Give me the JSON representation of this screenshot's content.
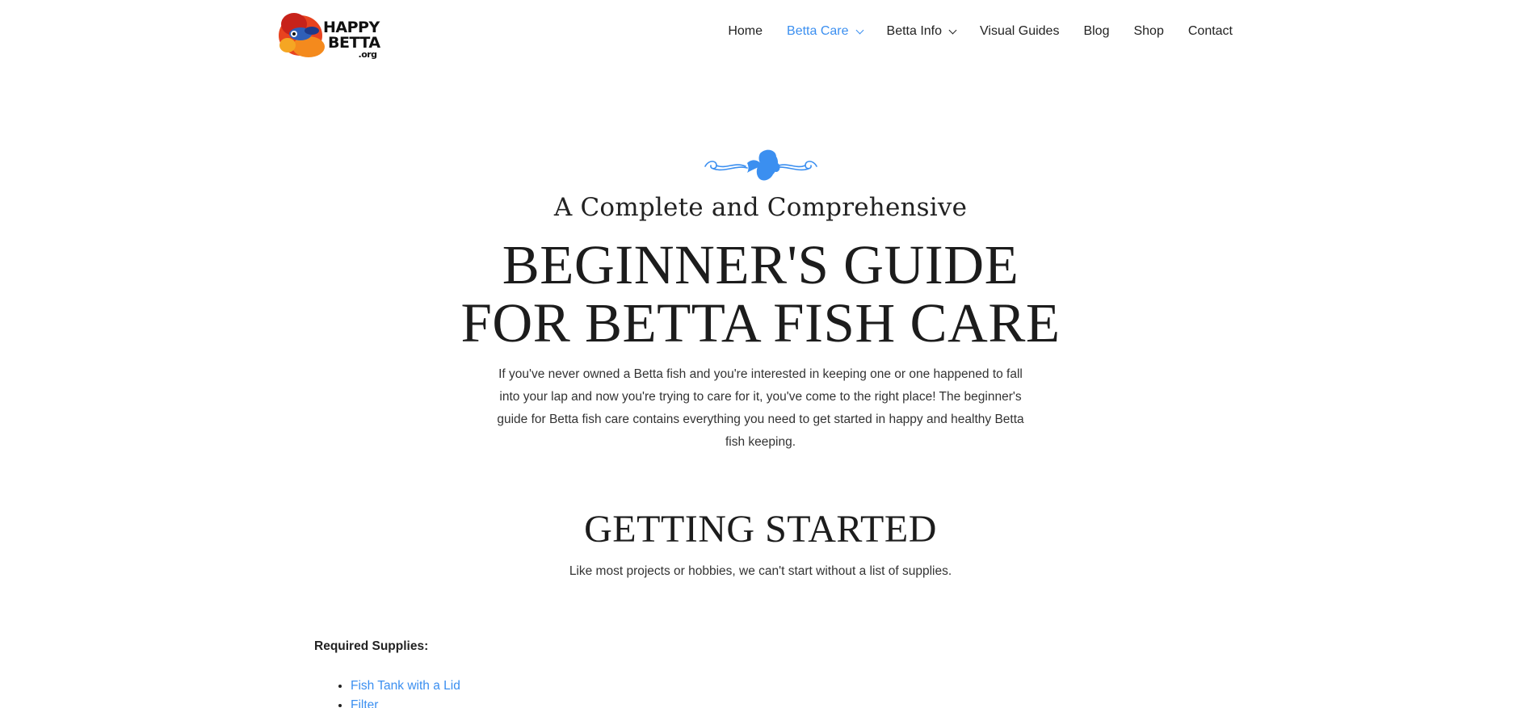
{
  "brand": {
    "logo_line1": "HAPPY",
    "logo_line2": "BETTA",
    "logo_line3": ".org"
  },
  "nav": {
    "items": [
      {
        "label": "Home"
      },
      {
        "label": "Betta Care",
        "active": true,
        "dropdown": true
      },
      {
        "label": "Betta Info",
        "dropdown": true
      },
      {
        "label": "Visual Guides"
      },
      {
        "label": "Blog"
      },
      {
        "label": "Shop"
      },
      {
        "label": "Contact"
      }
    ]
  },
  "hero": {
    "divider_icon": "betta-fish-flourish-icon",
    "subtitle": "A Complete and Comprehensive",
    "title": "BEGINNER'S GUIDE FOR BETTA FISH CARE",
    "intro": "If you've never owned a Betta fish and you're interested in keeping one or one happened to fall into your lap and now you're trying to care for it, you've come to the right place! The beginner's guide for Betta fish care contains everything you need to get started in happy and healthy Betta fish keeping."
  },
  "getting_started": {
    "title": "GETTING STARTED",
    "text": "Like most projects or hobbies, we can't start without a list of supplies."
  },
  "supplies": {
    "heading": "Required Supplies:",
    "items": [
      {
        "label": "Fish Tank with a Lid"
      },
      {
        "label": "Filter"
      }
    ]
  },
  "colors": {
    "accent": "#3b8ff0",
    "text": "#222222",
    "background": "#ffffff"
  }
}
